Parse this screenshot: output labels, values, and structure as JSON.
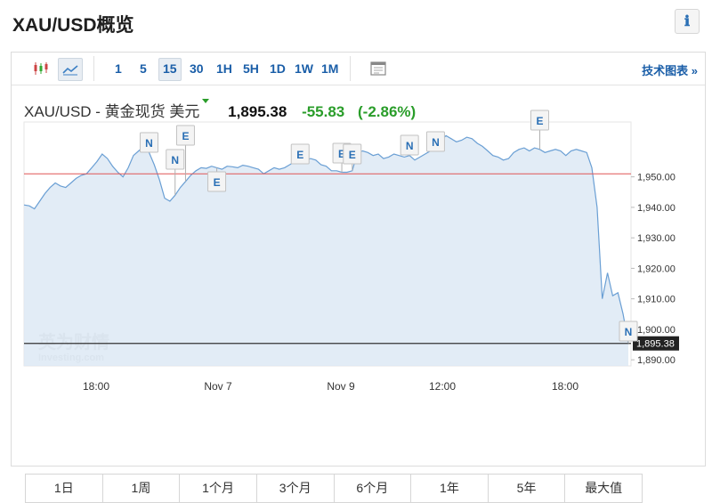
{
  "page": {
    "title": "XAU/USD概览",
    "info_icon": "ℹ"
  },
  "toolbar": {
    "icons": [
      "candlestick-chart-icon",
      "area-chart-icon"
    ],
    "intervals": [
      "1",
      "5",
      "15",
      "30",
      "1H",
      "5H",
      "1D",
      "1W",
      "1M"
    ],
    "active_interval": "15",
    "calendar_icon": "calendar-icon",
    "tech_chart_link": "技术图表 »"
  },
  "quote": {
    "symbol_label": "XAU/USD - 黄金现货 美元",
    "price": "1,895.38",
    "change": "-55.83",
    "change_pct": "(-2.86%)"
  },
  "chart_data": {
    "type": "area",
    "y_ticks": [
      "1,890.00",
      "1,900.00",
      "1,910.00",
      "1,920.00",
      "1,930.00",
      "1,940.00",
      "1,950.00"
    ],
    "x_ticks": [
      "18:00",
      "Nov 7",
      "Nov 9",
      "12:00",
      "18:00"
    ],
    "ylim": [
      1888,
      1968
    ],
    "grid": false,
    "reference_line": {
      "value": 1951,
      "color": "#e05555"
    },
    "current_line": {
      "value": 1895.38,
      "label": "1,895.38",
      "color": "#333333"
    },
    "series": [
      {
        "values": [
          1940.8,
          1940.5,
          1939.5,
          1942,
          1944.5,
          1946.5,
          1948,
          1947,
          1946.5,
          1948,
          1949.5,
          1950.5,
          1951,
          1953,
          1955,
          1957.5,
          1956,
          1953.5,
          1951.5,
          1950,
          1953,
          1957,
          1958.5,
          1960,
          1958,
          1954,
          1949,
          1943,
          1942,
          1944,
          1946.5,
          1948.5,
          1950.5,
          1952,
          1953,
          1952.8,
          1953.5,
          1953,
          1952.5,
          1953.5,
          1953.3,
          1953,
          1953.8,
          1953.5,
          1953,
          1952.5,
          1951,
          1952,
          1953,
          1952.5,
          1953,
          1954,
          1955,
          1954.5,
          1955.5,
          1956,
          1955.5,
          1954,
          1953.5,
          1952,
          1952,
          1951.5,
          1951.5,
          1952,
          1958,
          1958.5,
          1958,
          1957,
          1957.5,
          1956,
          1956.5,
          1957.5,
          1957,
          1956.5,
          1957,
          1955.5,
          1956.5,
          1957.5,
          1958.5,
          1960.5,
          1962,
          1963.5,
          1962.5,
          1961.5,
          1962,
          1963,
          1962.5,
          1961,
          1960,
          1958.5,
          1957,
          1956.5,
          1955.5,
          1956,
          1958,
          1959,
          1959.5,
          1958.5,
          1959.5,
          1959,
          1958,
          1958.5,
          1959,
          1958.5,
          1957,
          1958.5,
          1959,
          1958.5,
          1958,
          1953,
          1940,
          1910,
          1918.5,
          1911,
          1912,
          1905,
          1895.4
        ]
      }
    ],
    "markers": [
      {
        "letter": "N",
        "value": 1957.5
      },
      {
        "letter": "N",
        "value": 1953.5
      },
      {
        "letter": "E",
        "value": 1958.5
      },
      {
        "letter": "E",
        "value": 1943.5
      },
      {
        "letter": "E",
        "value": 1951.5
      },
      {
        "letter": "E",
        "value": 1953.5
      },
      {
        "letter": "E",
        "value": 1953.2
      },
      {
        "letter": "N",
        "value": 1955
      },
      {
        "letter": "N",
        "value": 1955.5
      },
      {
        "letter": "E",
        "value": 1962
      },
      {
        "letter": "N",
        "value": 1895.4
      }
    ],
    "watermark": {
      "line1": "英为财情",
      "line2": "Investing.com"
    }
  },
  "periods": [
    "1日",
    "1周",
    "1个月",
    "3个月",
    "6个月",
    "1年",
    "5年",
    "最大值"
  ]
}
